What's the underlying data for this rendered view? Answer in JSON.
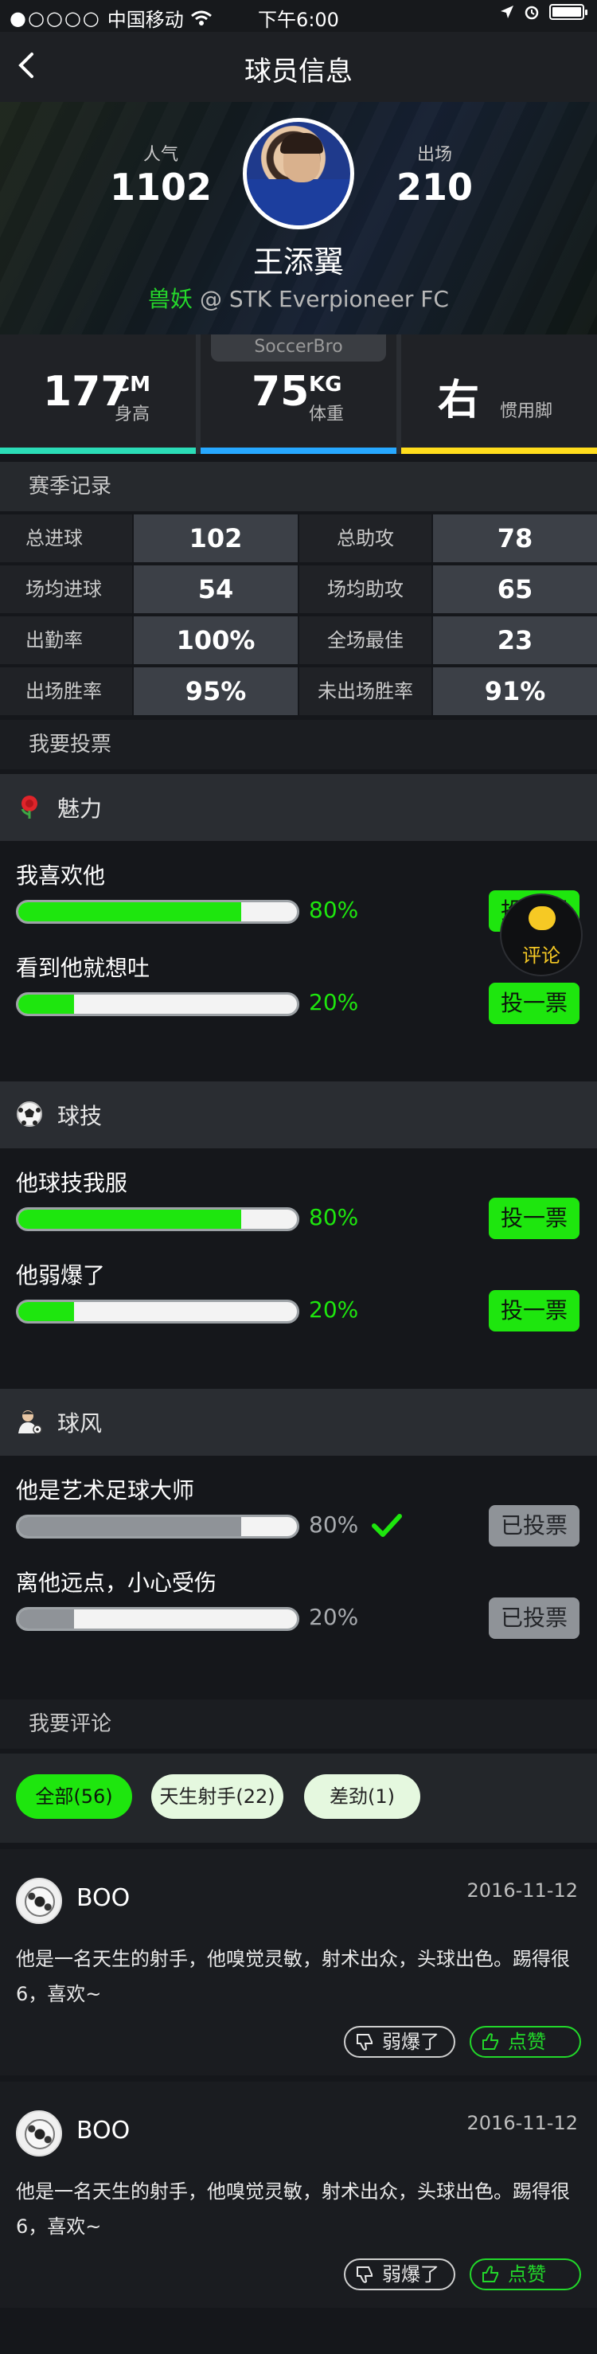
{
  "status": {
    "carrier": "中国移动",
    "time": "下午6:00"
  },
  "nav": {
    "title": "球员信息"
  },
  "hero": {
    "popularity_label": "人气",
    "popularity": "1102",
    "appearances_label": "出场",
    "appearances": "210",
    "name": "王添翼",
    "nickname": "兽妖",
    "team": " @ STK Everpioneer FC"
  },
  "attributes": {
    "badge": "SoccerBro",
    "height": {
      "value": "177",
      "unit": "CM",
      "label": "身高",
      "color": "#2bdcb7"
    },
    "weight": {
      "value": "75",
      "unit": "KG",
      "label": "体重",
      "color": "#27a8ff"
    },
    "foot": {
      "value": "右",
      "label": "惯用脚",
      "color": "#ffdd1c"
    }
  },
  "season": {
    "title": "赛季记录",
    "rows": [
      {
        "k1": "总进球",
        "v1": "102",
        "k2": "总助攻",
        "v2": "78"
      },
      {
        "k1": "场均进球",
        "v1": "54",
        "k2": "场均助攻",
        "v2": "65"
      },
      {
        "k1": "出勤率",
        "v1": "100%",
        "k2": "全场最佳",
        "v2": "23"
      },
      {
        "k1": "出场胜率",
        "v1": "95%",
        "k2": "未出场胜率",
        "v2": "91%"
      }
    ]
  },
  "vote": {
    "title": "我要投票",
    "categories": [
      {
        "title": "魅力",
        "icon": "rose-icon",
        "items": [
          {
            "q": "我喜欢他",
            "pct_text": "80%",
            "pct": 0.8,
            "button": "投一票",
            "voted": false
          },
          {
            "q": "看到他就想吐",
            "pct_text": "20%",
            "pct": 0.2,
            "button": "投一票",
            "voted": false
          }
        ]
      },
      {
        "title": "球技",
        "icon": "soccer-ball-icon",
        "items": [
          {
            "q": "他球技我服",
            "pct_text": "80%",
            "pct": 0.8,
            "button": "投一票",
            "voted": false
          },
          {
            "q": "他弱爆了",
            "pct_text": "20%",
            "pct": 0.2,
            "button": "投一票",
            "voted": false
          }
        ]
      },
      {
        "title": "球风",
        "icon": "player-icon",
        "items": [
          {
            "q": "他是艺术足球大师",
            "pct_text": "80%",
            "pct": 0.8,
            "button": "已投票",
            "voted": true
          },
          {
            "q": "离他远点，小心受伤",
            "pct_text": "20%",
            "pct": 0.2,
            "button": "已投票",
            "voted": true
          }
        ]
      }
    ],
    "fab_label": "评论"
  },
  "comments": {
    "title": "我要评论",
    "filters": [
      {
        "label": "全部(56)",
        "active": true
      },
      {
        "label": "天生射手(22)",
        "active": false
      },
      {
        "label": "差劲(1)",
        "active": false
      }
    ],
    "items": [
      {
        "user": "BOO",
        "date": "2016-11-12",
        "text": "他是一名天生的射手，他嗅觉灵敏，射术出众，头球出色。踢得很6，喜欢~",
        "dislike": "弱爆了",
        "like": "点赞"
      },
      {
        "user": "BOO",
        "date": "2016-11-12",
        "text": "他是一名天生的射手，他嗅觉灵敏，射术出众，头球出色。踢得很6，喜欢~",
        "dislike": "弱爆了",
        "like": "点赞"
      }
    ]
  },
  "colors": {
    "accent_green": "#1ee60e",
    "bar_gray": "#8f9398"
  }
}
